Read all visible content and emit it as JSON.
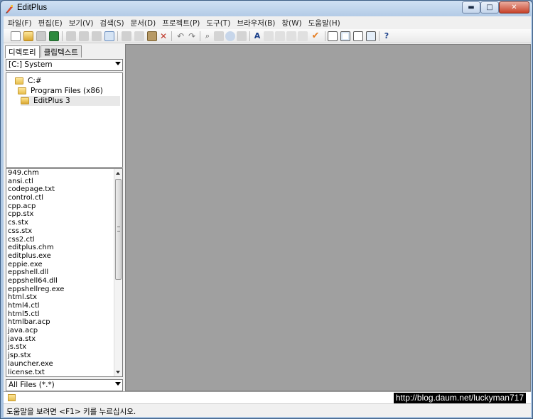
{
  "window": {
    "title": "EditPlus",
    "minimize": "▬",
    "maximize": "□",
    "close": "✕"
  },
  "menu": [
    "파일(F)",
    "편집(E)",
    "보기(V)",
    "검색(S)",
    "문서(D)",
    "프로젝트(P)",
    "도구(T)",
    "브라우저(B)",
    "창(W)",
    "도움말(H)"
  ],
  "sidebar": {
    "tabs": [
      "디렉토리",
      "클립텍스트"
    ],
    "drive": "[C:] System",
    "tree": [
      "C:#",
      "Program Files (x86)",
      "EditPlus 3"
    ],
    "files": [
      "949.chm",
      "ansi.ctl",
      "codepage.txt",
      "control.ctl",
      "cpp.acp",
      "cpp.stx",
      "cs.stx",
      "css.stx",
      "css2.ctl",
      "editplus.chm",
      "editplus.exe",
      "eppie.exe",
      "eppshell.dll",
      "eppshell64.dll",
      "eppshellreg.exe",
      "html.stx",
      "html4.ctl",
      "html5.ctl",
      "htmlbar.acp",
      "java.acp",
      "java.stx",
      "js.stx",
      "jsp.stx",
      "launcher.exe",
      "license.txt"
    ],
    "filter": "All Files (*.*)"
  },
  "watermark": "http://blog.daum.net/luckyman717",
  "status": "도움말을 보려면 <F1> 키를 누르십시오.",
  "colors": {
    "editor_bg": "#a0a0a0",
    "menu_bg": "#f0f0f0",
    "close_btn": "#c7432b"
  }
}
